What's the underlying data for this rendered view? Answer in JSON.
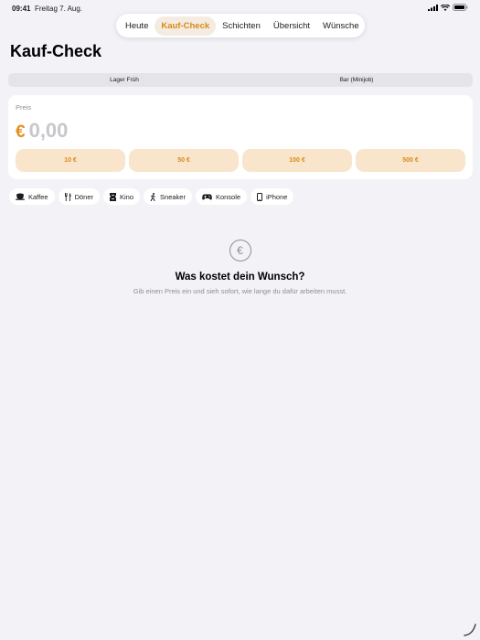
{
  "status_bar": {
    "time": "09:41",
    "date": "Freitag 7. Aug."
  },
  "tabs": [
    {
      "label": "Heute",
      "active": false
    },
    {
      "label": "Kauf-Check",
      "active": true
    },
    {
      "label": "Schichten",
      "active": false
    },
    {
      "label": "Übersicht",
      "active": false
    },
    {
      "label": "Wünsche",
      "active": false
    }
  ],
  "page": {
    "title": "Kauf-Check"
  },
  "jobs_segment": [
    {
      "label": "Lager Früh"
    },
    {
      "label": "Bar (Minijob)"
    }
  ],
  "price_card": {
    "label": "Preis",
    "currency": "€",
    "value": "0,00",
    "quick_amounts": [
      "10 €",
      "50 €",
      "100 €",
      "500 €"
    ]
  },
  "presets": [
    {
      "label": "Kaffee",
      "icon": "coffee-cup-icon"
    },
    {
      "label": "Döner",
      "icon": "fork-knife-icon"
    },
    {
      "label": "Kino",
      "icon": "ticket-icon"
    },
    {
      "label": "Sneaker",
      "icon": "walking-figure-icon"
    },
    {
      "label": "Konsole",
      "icon": "gamecontroller-icon"
    },
    {
      "label": "iPhone",
      "icon": "phone-icon"
    }
  ],
  "empty_state": {
    "icon": "euro-circle-icon",
    "title": "Was kostet dein Wunsch?",
    "subtitle": "Gib einen Preis ein und sieh sofort, wie lange du dafür arbeiten musst."
  },
  "colors": {
    "accent": "#e2901f",
    "accent_soft": "#f9e5cc",
    "background": "#f2f2f7",
    "card": "#ffffff"
  }
}
